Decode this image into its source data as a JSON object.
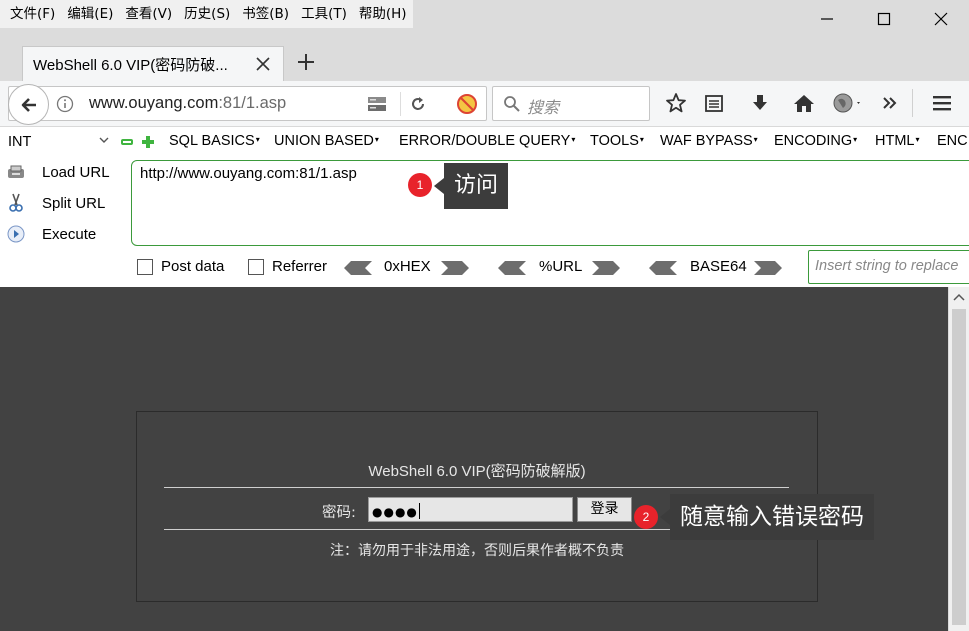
{
  "menubar": {
    "items": [
      "文件(F)",
      "编辑(E)",
      "查看(V)",
      "历史(S)",
      "书签(B)",
      "工具(T)",
      "帮助(H)"
    ]
  },
  "window_controls": {
    "minimize": "minimize-icon",
    "maximize": "maximize-icon",
    "close": "close-icon"
  },
  "tab": {
    "title": "WebShell 6.0 VIP(密码防破..."
  },
  "navbar": {
    "url_host": "www.ouyang.com",
    "url_rest": ":81/1.asp",
    "search_placeholder": "搜索"
  },
  "hackbar": {
    "select_value": "INT",
    "menus": [
      "SQL BASICS",
      "UNION BASED",
      "ERROR/DOUBLE QUERY",
      "TOOLS",
      "WAF BYPASS",
      "ENCODING",
      "HTML",
      "ENC"
    ],
    "buttons": [
      "Load URL",
      "Split URL",
      "Execute"
    ],
    "url_value": "http://www.ouyang.com:81/1.asp",
    "post_data_label": "Post data",
    "referrer_label": "Referrer",
    "encoders": [
      "0xHEX",
      "%URL",
      "BASE64"
    ],
    "replace_placeholder": "Insert string to replace"
  },
  "callouts": {
    "one": {
      "badge": "1",
      "text": "访问"
    },
    "two": {
      "badge": "2",
      "text": "随意输入错误密码"
    }
  },
  "page": {
    "title": "WebShell 6.0 VIP(密码防破解版)",
    "password_label": "密码:",
    "password_mask": "●●●●",
    "login_button": "登录",
    "note": "注：请勿用于非法用途，否则后果作者概不负责"
  },
  "colors": {
    "accent_green": "#3b9a3b",
    "badge_red": "#e8232b",
    "page_bg": "#424242"
  }
}
